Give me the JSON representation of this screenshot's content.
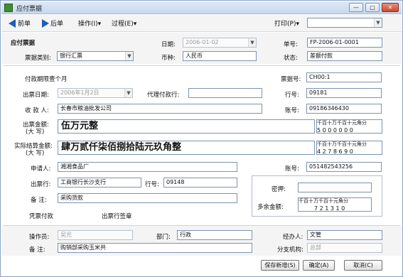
{
  "window": {
    "title": "应付票据",
    "min": "—",
    "max": "□",
    "close": "✕"
  },
  "toolbar": {
    "prev": "前单",
    "next": "后单",
    "operate": "操作(I)▾",
    "filter": "过程(E)▾",
    "print": "打印(P)▾",
    "print_select": ""
  },
  "header": {
    "section_title": "应付票据",
    "date_label": "日期:",
    "date_value": "2006-01-02",
    "billno_label": "单号:",
    "billno_value": "FP-2006-01-0001",
    "type_label": "票据类别:",
    "type_value": "银行汇票",
    "currency_label": "币种:",
    "currency_value": "人民币",
    "status_label": "状态:",
    "status_value": "差额付款"
  },
  "main": {
    "validity": "付款期限壹个月",
    "billcode_label": "票据号:",
    "billcode_value": "CH00:1",
    "issue_date_label": "出票日期:",
    "issue_date_value": "2006年1月2日",
    "agent_bank_label": "代理付款行:",
    "agent_bank_value": "",
    "row_label": "行号:",
    "row_value": "09181",
    "payee_label": "收 款 人:",
    "payee_value": "长春市粮油批发公司",
    "acct_label": "账号:",
    "acct_value": "09186346430",
    "amount_label": "出票金额:",
    "amount_sub": "(大 写)",
    "amount_value": "伍万元整",
    "amount_hdr": "千百十万千百十元角分",
    "amount_digits": " 5 0 0 0 0 0 0",
    "settle_label": "实际结算金额:",
    "settle_sub": "(大 写)",
    "settle_value": "肆万贰仟柒佰捌拾陆元玖角整",
    "settle_hdr": "千百十万千百十元角分",
    "settle_digits": " 4 2 7 8 6 9 0",
    "applicant_label": "申请人:",
    "applicant_value": "湘湘食品厂",
    "acct2_label": "账号:",
    "acct2_value": "051482543256",
    "bank_label": "出票行:",
    "bank_value": "工商银行长沙支行",
    "bankno_label": "行号:",
    "bankno_value": "09148",
    "note_label": "备 注:",
    "note_value": "采购货款",
    "remain_ref_label": "密押:",
    "remain_ref_value": "",
    "remain_label": "多余金额:",
    "remain_hdr": "千百十万千百十元角分",
    "remain_digits": "7 2 1 3 1 0",
    "payment_label": "凭票付款",
    "sign_label": "出票行签章"
  },
  "footer": {
    "operator_label": "操作员:",
    "operator_value": "吴光",
    "dept_label": "部门:",
    "dept_value": "行政",
    "handler_label": "经办人:",
    "handler_value": "文管",
    "remark_label": "备 注:",
    "remark_value": "购销部采购玉米共",
    "branch_label": "分支机构:",
    "branch_value": "总部"
  },
  "buttons": {
    "save_new": "保存新增(S)",
    "ok": "确定(A)",
    "cancel": "取消(C)"
  }
}
